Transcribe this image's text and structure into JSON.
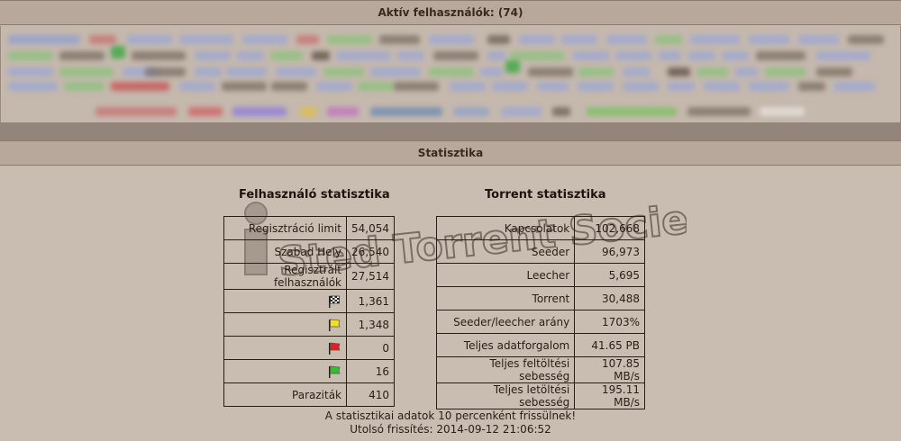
{
  "active_users": {
    "title": "Aktív felhasználók: (74)"
  },
  "statistics": {
    "title": "Statisztika",
    "user_stats": {
      "title": "Felhasználó statisztika",
      "rows": [
        {
          "label": "Regisztráció limit",
          "value": "54,054"
        },
        {
          "label": "Szabad Hely",
          "value": "26,540"
        },
        {
          "label": "Regisztrált felhasználók",
          "value": "27,514"
        },
        {
          "icon": "checkered-flag-icon",
          "value": "1,361"
        },
        {
          "icon": "yellow-flag-icon",
          "value": "1,348"
        },
        {
          "icon": "red-flag-icon",
          "value": "0"
        },
        {
          "icon": "green-flag-icon",
          "value": "16"
        },
        {
          "label": "Paraziták",
          "value": "410"
        }
      ]
    },
    "torrent_stats": {
      "title": "Torrent statisztika",
      "rows": [
        {
          "label": "Kapcsolatok",
          "value": "102,668"
        },
        {
          "label": "Seeder",
          "value": "96,973"
        },
        {
          "label": "Leecher",
          "value": "5,695"
        },
        {
          "label": "Torrent",
          "value": "30,488"
        },
        {
          "label": "Seeder/leecher arány",
          "value": "1703%"
        },
        {
          "label": "Teljes adatforgalom",
          "value": "41.65 PB"
        },
        {
          "label": "Teljes feltöltési sebesség",
          "value": "107.85 MB/s"
        },
        {
          "label": "Teljes letöltési sebesség",
          "value": "195.11 MB/s"
        }
      ]
    },
    "footer": {
      "note": "A statisztikai adatok 10 percenként frissülnek!",
      "updated": "Utolsó frissítés: 2014-09-12 21:06:52"
    }
  },
  "colors": {
    "header_bg": "#b7a89b",
    "page_bg": "#c9bdb2",
    "divider": "#93857a",
    "text": "#2a1e14"
  }
}
